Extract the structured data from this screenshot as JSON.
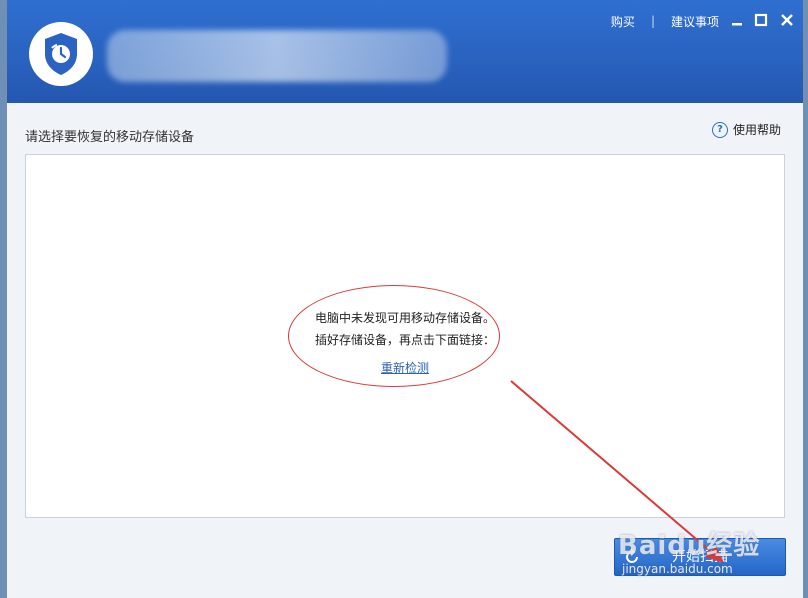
{
  "header": {
    "links": [
      {
        "label": "购买"
      },
      {
        "label": "建议事项"
      }
    ],
    "separator": "|",
    "window_controls": {
      "minimize": "minimize-icon",
      "maximize": "maximize-icon",
      "close": "close-icon"
    },
    "logo_icon": "shield-clock-icon"
  },
  "main": {
    "subtitle": "请选择要恢复的移动存储设备",
    "help_label": "使用帮助",
    "help_icon": "?",
    "message_line1": "电脑中未发现可用移动存储设备。",
    "message_line2": "插好存储设备，再点击下面链接：",
    "rescan_link": "重新检测"
  },
  "footer": {
    "scan_button": "开始扫描"
  },
  "watermark": {
    "brand": "Baidu经验",
    "url": "jingyan.baidu.com"
  },
  "colors": {
    "header_blue": "#2a63c1",
    "annotation_red": "#d93a3a",
    "link_blue": "#2c63b8"
  }
}
